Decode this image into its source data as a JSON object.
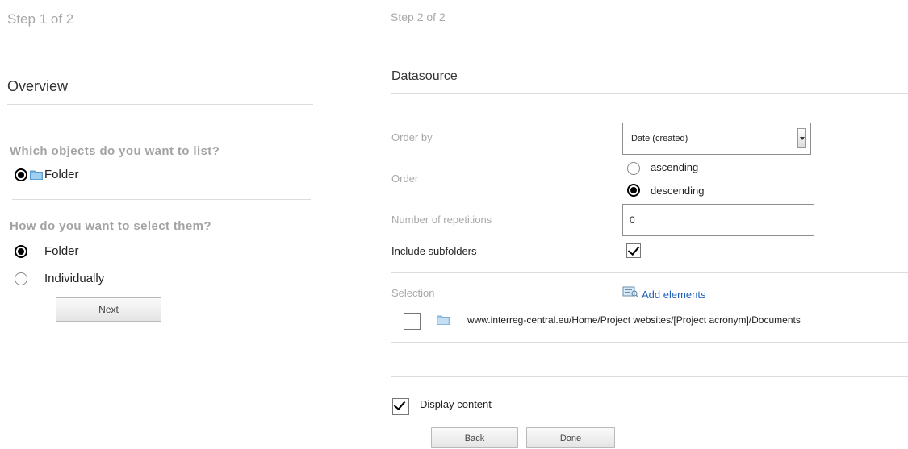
{
  "step1": {
    "step_label": "Step 1 of 2",
    "title": "Overview",
    "question1": "Which objects do you want to list?",
    "objects_option": "Folder",
    "question2": "How do you want to select them?",
    "select_options": [
      {
        "label": "Folder",
        "selected": true
      },
      {
        "label": "Individually",
        "selected": false
      }
    ],
    "next_label": "Next"
  },
  "step2": {
    "step_label": "Step 2 of 2",
    "title": "Datasource",
    "order_by_label": "Order by",
    "order_by_value": "Date (created)",
    "order_label": "Order",
    "order_options": [
      {
        "label": "ascending",
        "selected": false
      },
      {
        "label": "descending",
        "selected": true
      }
    ],
    "repetitions_label": "Number of repetitions",
    "repetitions_value": "0",
    "subfolders_label": "Include subfolders",
    "subfolders_checked": true,
    "selection_label": "Selection",
    "add_elements_label": "Add elements",
    "selection_path": "www.interreg-central.eu/Home/Project websites/[Project acronym]/Documents",
    "display_content_label": "Display content",
    "display_content_checked": true,
    "back_label": "Back",
    "done_label": "Done"
  },
  "colors": {
    "folder_icon": "#5aa7dd",
    "link": "#1f5fb8"
  }
}
